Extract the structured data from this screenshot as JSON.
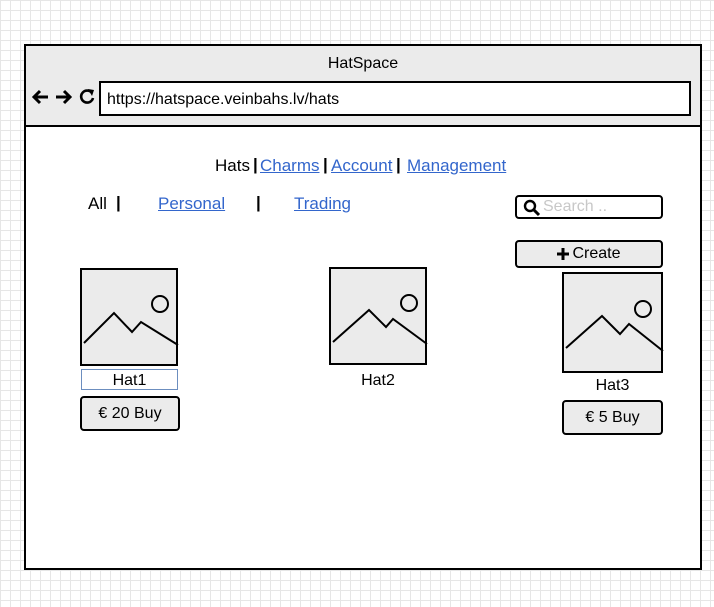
{
  "window": {
    "title": "HatSpace",
    "url": "https://hatspace.veinbahs.lv/hats"
  },
  "nav_icons": [
    "back-arrow-icon",
    "forward-arrow-icon",
    "reload-icon"
  ],
  "main_nav": {
    "items": [
      {
        "label": "Hats",
        "active": true
      },
      {
        "label": "Charms",
        "active": false
      },
      {
        "label": "Account",
        "active": false
      },
      {
        "label": "Management",
        "active": false
      }
    ],
    "separator": "|"
  },
  "filters": {
    "items": [
      {
        "label": "All",
        "active": true
      },
      {
        "label": "Personal",
        "active": false
      },
      {
        "label": "Trading",
        "active": false
      }
    ],
    "separator": "|"
  },
  "search": {
    "placeholder": "Search .."
  },
  "create_button": {
    "label": "Create",
    "icon": "plus-icon"
  },
  "products": [
    {
      "name": "Hat1",
      "price_label": "€ 20 Buy",
      "icon": "image-placeholder-icon"
    },
    {
      "name": "Hat2",
      "price_label": "",
      "icon": "image-placeholder-icon"
    },
    {
      "name": "Hat3",
      "price_label": "€ 5 Buy",
      "icon": "image-placeholder-icon"
    }
  ],
  "colors": {
    "link": "#3366cc",
    "chrome": "#ebebeb",
    "selection_outline": "#6c8ebf"
  }
}
